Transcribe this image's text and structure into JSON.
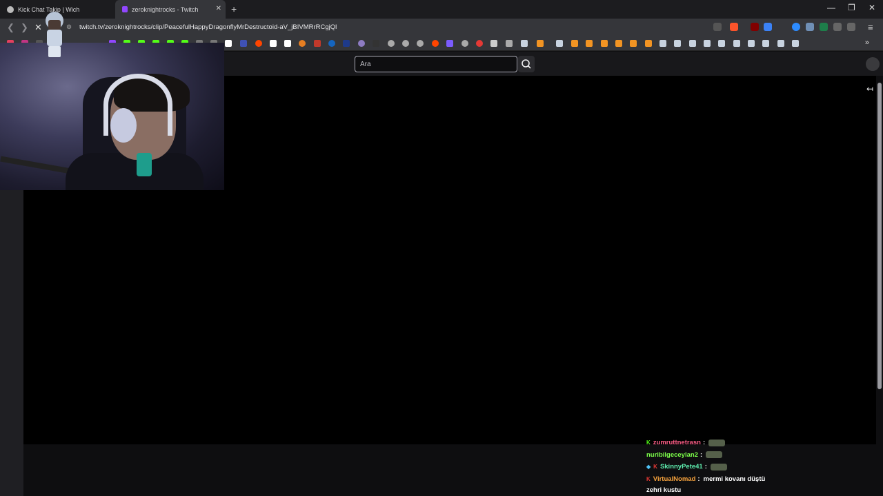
{
  "browser": {
    "tabs": [
      {
        "title": "Kick Chat Takip | Wich",
        "active": false
      },
      {
        "title": "zeroknightrocks - Twitch",
        "active": true
      }
    ],
    "url": "twitch.tv/zeroknightrocks/clip/PeacefulHappyDragonflyMrDestructoid-aV_jBIVMRrRCgjQl",
    "window_controls": [
      "minimize-icon",
      "restore-icon",
      "close-icon"
    ]
  },
  "twitch": {
    "search_placeholder": "Ara"
  },
  "chat": {
    "messages": [
      {
        "badges": [
          "kick-badge"
        ],
        "user": "zumruttnetrasn",
        "user_color": "#ff5f89",
        "text": "",
        "emote": true
      },
      {
        "badges": [],
        "user": "nuribilgeceylan2",
        "user_color": "#7cff4a",
        "text": "",
        "emote": true
      },
      {
        "badges": [
          "gem-badge",
          "kick-badge"
        ],
        "user": "SkinnyPete41",
        "user_color": "#5ff0b0",
        "text": "",
        "emote": true
      },
      {
        "badges": [
          "kick-badge"
        ],
        "user": "VirtualNomad",
        "user_color": "#f6a23d",
        "text": "mermi kovanı düştü",
        "emote": false
      }
    ],
    "continuation": "zehri kustu"
  },
  "colors": {
    "twitch_bg": "#0e0e10",
    "player_bg": "#000000",
    "browser_chrome": "#35363a"
  }
}
